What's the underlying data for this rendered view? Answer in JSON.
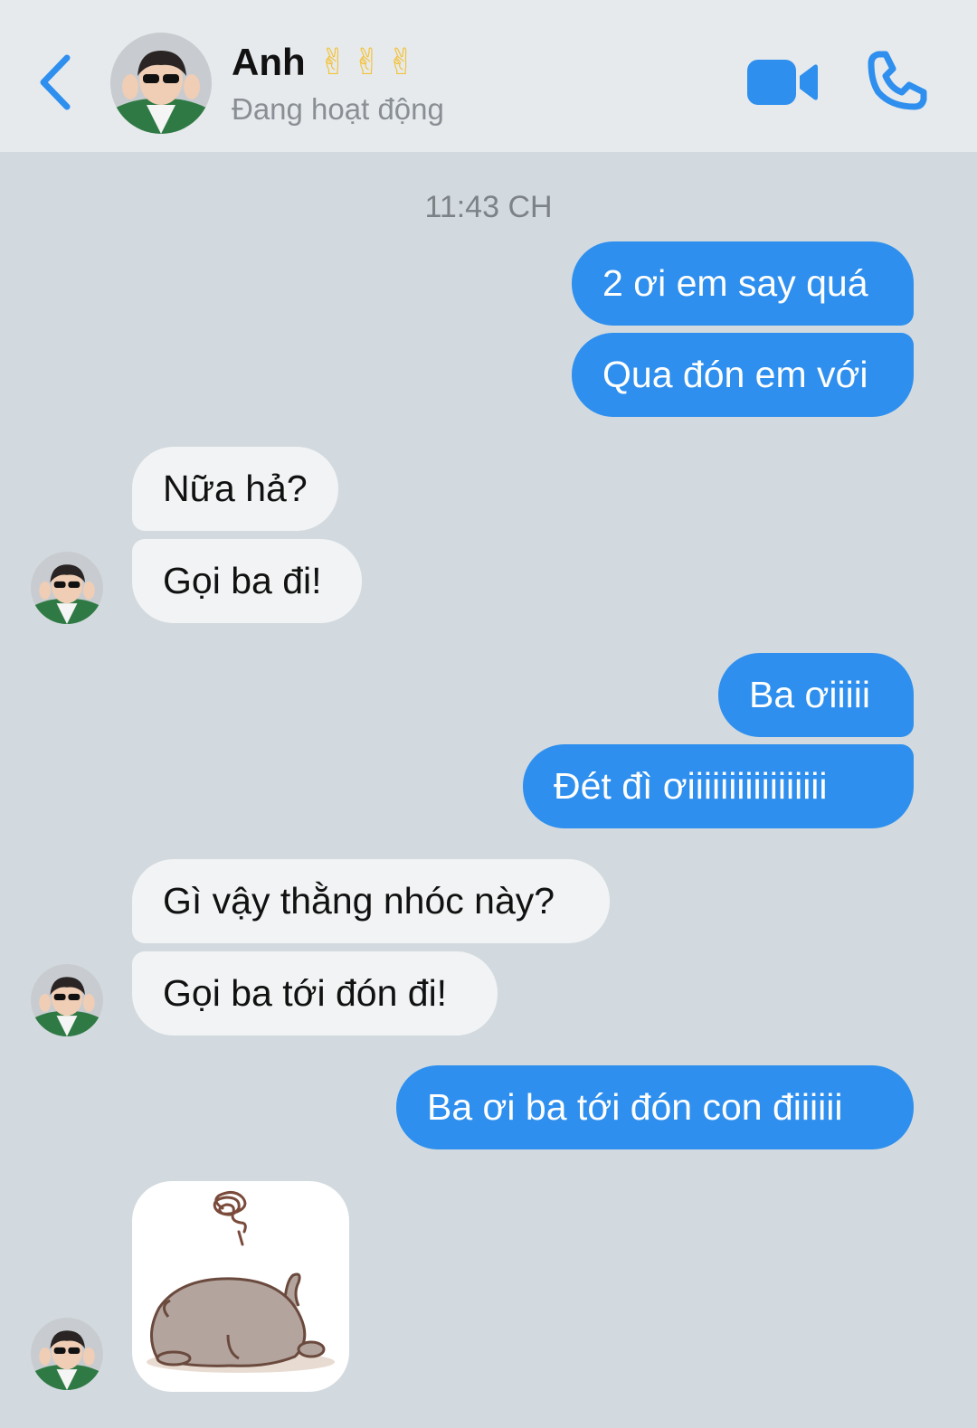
{
  "header": {
    "name": "Anh",
    "emojis": "✌✌✌",
    "status": "Đang hoạt động"
  },
  "conversation": {
    "timestamp": "11:43 CH",
    "messages": [
      {
        "id": "m1",
        "from": "me",
        "text": "2 ơi em say quá"
      },
      {
        "id": "m2",
        "from": "me",
        "text": "Qua đón em với"
      },
      {
        "id": "m3",
        "from": "contact",
        "text": "Nữa hả?"
      },
      {
        "id": "m4",
        "from": "contact",
        "text": "Gọi ba đi!"
      },
      {
        "id": "m5",
        "from": "me",
        "text": "Ba ơiiiii"
      },
      {
        "id": "m6",
        "from": "me",
        "text": "Đét đì ơiiiiiiiiiiiiiiiii"
      },
      {
        "id": "m7",
        "from": "contact",
        "text": "Gì vậy thằng nhóc này?"
      },
      {
        "id": "m8",
        "from": "contact",
        "text": "Gọi ba tới đón đi!"
      },
      {
        "id": "m9",
        "from": "me",
        "text": "Ba ơi ba tới đón con điiiiii"
      }
    ],
    "sticker": {
      "from": "contact",
      "icon": "sleeping-cat-sticker"
    }
  },
  "icons": {
    "back": "chevron-left-icon",
    "video": "video-camera-icon",
    "call": "phone-icon"
  },
  "colors": {
    "accent": "#2e8fee",
    "background": "#d2dadf",
    "header": "#e6eaec",
    "incoming_bubble": "#f2f3f4"
  }
}
